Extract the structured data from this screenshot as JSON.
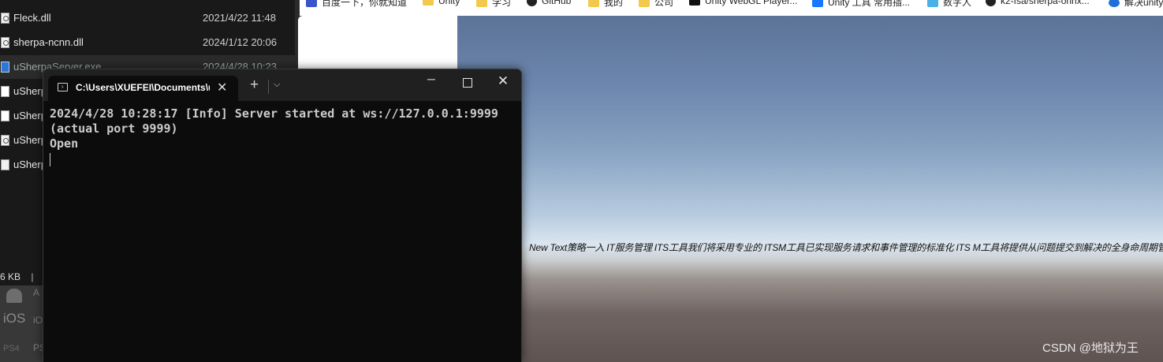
{
  "explorer": {
    "files": [
      {
        "name": "Fleck.dll",
        "date": "2021/4/22 11:48",
        "icon": "gear-file-icon"
      },
      {
        "name": "sherpa-ncnn.dll",
        "date": "2024/1/12 20:06",
        "icon": "gear-file-icon"
      },
      {
        "name": "uSherpaServer.exe",
        "date": "2024/4/28 10:23",
        "icon": "exe-icon"
      },
      {
        "name": "uSherp",
        "date": "",
        "icon": "unity-file-icon"
      },
      {
        "name": "uSherp",
        "date": "",
        "icon": "unity-file-icon"
      },
      {
        "name": "uSherp",
        "date": "",
        "icon": "gear-file-icon"
      },
      {
        "name": "uSherp",
        "date": "",
        "icon": "blank-file-icon"
      }
    ],
    "status_size": "6 KB",
    "status_sep": "|"
  },
  "build_panel": {
    "android_label": "A",
    "ios_label": "iOS",
    "ios_sub": "iO",
    "ps4_label": "PS4",
    "ps4_sub": "PS"
  },
  "bookmarks": [
    {
      "label": "百度一下，你就知道",
      "icon": "baidu-icon"
    },
    {
      "label": "Unity",
      "icon": "folder-icon"
    },
    {
      "label": "学习",
      "icon": "folder-icon"
    },
    {
      "label": "GitHub",
      "icon": "github-icon"
    },
    {
      "label": "我的",
      "icon": "folder-icon"
    },
    {
      "label": "公司",
      "icon": "folder-icon"
    },
    {
      "label": "Unity WebGL Player...",
      "icon": "unity-icon"
    },
    {
      "label": "Unity 工具 常用插...",
      "icon": "zhihu-icon"
    },
    {
      "label": "数字人",
      "icon": "shuziren-icon"
    },
    {
      "label": "k2-fsa/sherpa-onnx...",
      "icon": "github-icon"
    },
    {
      "label": "解决unity",
      "icon": "edge-icon"
    }
  ],
  "game_view": {
    "text": "New Text策略一入 IT服务管理 ITS工具我们将采用专业的 ITSM工具已实现服务请求和事件管理的标准化 ITS M工具将提供从问题提交到解决的全身命周期管理。",
    "watermark": "CSDN @地狱为王"
  },
  "terminal": {
    "tab_title": "C:\\Users\\XUEFEI\\Documents\\uSherpaServer",
    "close_glyph": "✕",
    "new_tab_glyph": "+",
    "dropdown_glyph": "⌵",
    "minimize_glyph": "─",
    "close_window_glyph": "✕",
    "lines": [
      "2024/4/28 10:28:17 [Info] Server started at ws://127.0.0.1:9999",
      "(actual port 9999)",
      "Open"
    ]
  }
}
